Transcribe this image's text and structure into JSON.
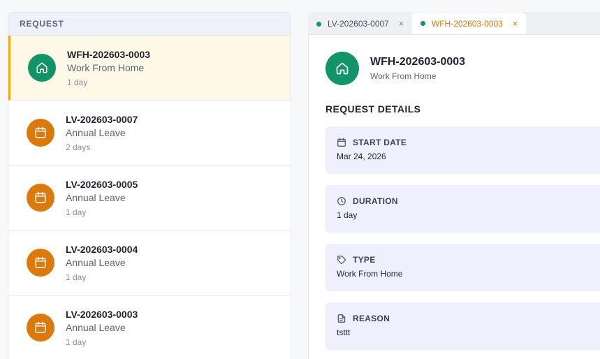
{
  "list": {
    "header": "REQUEST",
    "items": [
      {
        "id": "WFH-202603-0003",
        "type": "Work From Home",
        "duration": "1 day",
        "icon": "home-icon",
        "color": "#129368",
        "active": true
      },
      {
        "id": "LV-202603-0007",
        "type": "Annual Leave",
        "duration": "2 days",
        "icon": "calendar-icon",
        "color": "#db7a0b",
        "active": false
      },
      {
        "id": "LV-202603-0005",
        "type": "Annual Leave",
        "duration": "1 day",
        "icon": "calendar-icon",
        "color": "#db7a0b",
        "active": false
      },
      {
        "id": "LV-202603-0004",
        "type": "Annual Leave",
        "duration": "1 day",
        "icon": "calendar-icon",
        "color": "#db7a0b",
        "active": false
      },
      {
        "id": "LV-202603-0003",
        "type": "Annual Leave",
        "duration": "1 day",
        "icon": "calendar-icon",
        "color": "#db7a0b",
        "active": false
      }
    ]
  },
  "tabs": [
    {
      "label": "LV-202603-0007",
      "close": "×",
      "active": false
    },
    {
      "label": "WFH-202603-0003",
      "close": "×",
      "active": true
    }
  ],
  "detail": {
    "title": "WFH-202603-0003",
    "subtitle": "Work From Home",
    "section_title": "REQUEST DETAILS",
    "fields": [
      {
        "label": "START DATE",
        "value": "Mar 24, 2026",
        "icon": "calendar-icon"
      },
      {
        "label": "DURATION",
        "value": "1 day",
        "icon": "clock-icon"
      },
      {
        "label": "TYPE",
        "value": "Work From Home",
        "icon": "tag-icon"
      },
      {
        "label": "REASON",
        "value": "tsttt",
        "icon": "document-icon"
      }
    ]
  },
  "colors": {
    "accent": "#f3a712",
    "wfh": "#129368",
    "leave": "#db7a0b",
    "active_tab": "#d8790f"
  }
}
